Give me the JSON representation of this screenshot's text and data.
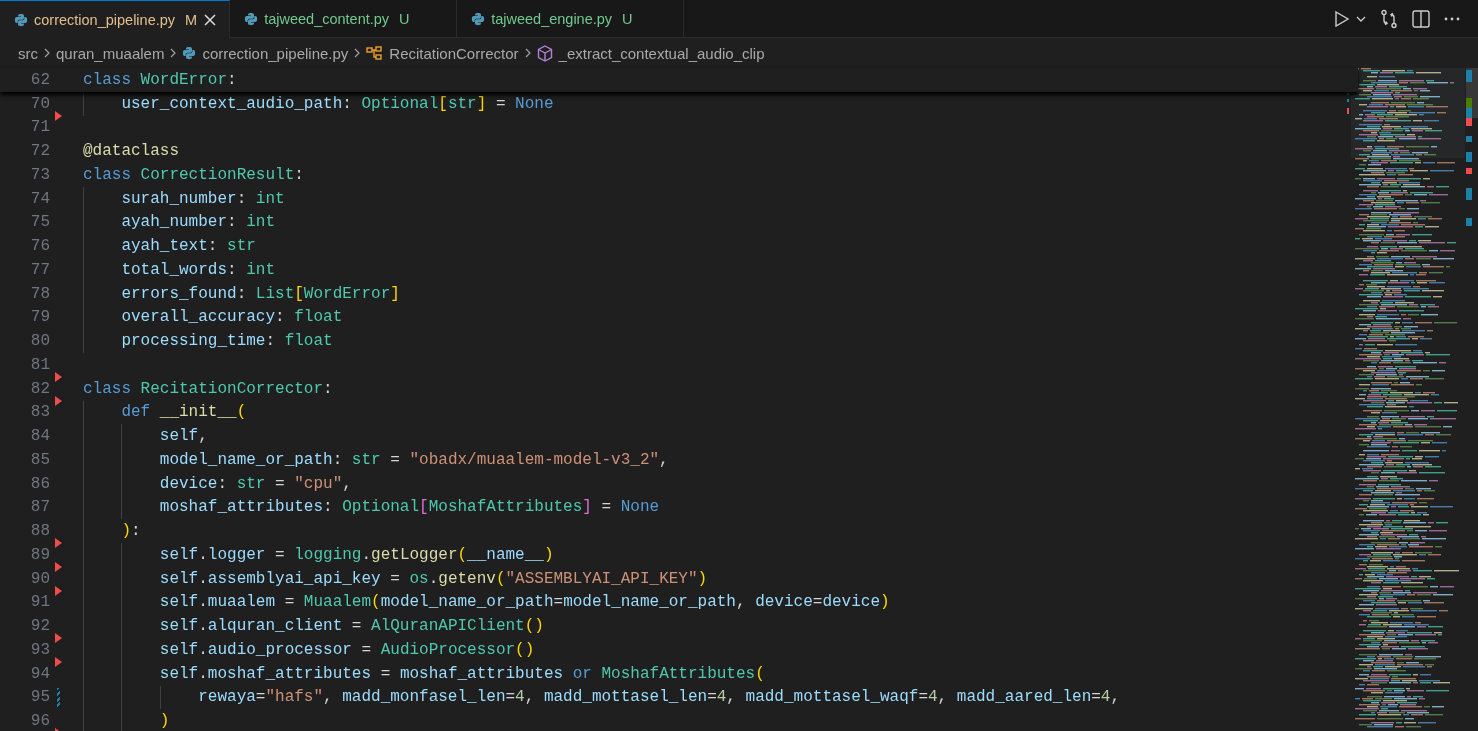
{
  "tabs": [
    {
      "label": "correction_pipeline.py",
      "kind": "modified",
      "badge": "M",
      "selected": true
    },
    {
      "label": "tajweed_content.py",
      "kind": "untracked",
      "badge": "U",
      "selected": false
    },
    {
      "label": "tajweed_engine.py",
      "kind": "untracked",
      "badge": "U",
      "selected": false
    }
  ],
  "breadcrumb": [
    {
      "kind": "folder",
      "label": "src"
    },
    {
      "kind": "folder",
      "label": "quran_muaalem"
    },
    {
      "kind": "file",
      "label": "correction_pipeline.py"
    },
    {
      "kind": "class",
      "label": "RecitationCorrector"
    },
    {
      "kind": "method",
      "label": "_extract_contextual_audio_clip"
    }
  ],
  "sticky_scroll": {
    "number": "62",
    "tokens": [
      {
        "kind": "kw",
        "text": "class "
      },
      {
        "kind": "cls",
        "text": "WordError"
      },
      {
        "kind": "op",
        "text": ":"
      }
    ]
  },
  "lines": [
    {
      "number": "70",
      "kind": "deleted",
      "tokens": [
        {
          "kind": "var",
          "text": "    user_context_audio_path"
        },
        {
          "kind": "op",
          "text": ": "
        },
        {
          "kind": "cls",
          "text": "Optional"
        },
        {
          "kind": "br1",
          "text": "["
        },
        {
          "kind": "cls",
          "text": "str"
        },
        {
          "kind": "br1",
          "text": "]"
        },
        {
          "kind": "op",
          "text": " = "
        },
        {
          "kind": "kw",
          "text": "None"
        }
      ]
    },
    {
      "number": "71",
      "kind": "normal"
    },
    {
      "number": "72",
      "kind": "normal",
      "tokens": [
        {
          "kind": "fn",
          "text": "@dataclass"
        }
      ]
    },
    {
      "number": "73",
      "kind": "normal",
      "tokens": [
        {
          "kind": "kw",
          "text": "class "
        },
        {
          "kind": "cls",
          "text": "CorrectionResult"
        },
        {
          "kind": "op",
          "text": ":"
        }
      ]
    },
    {
      "number": "74",
      "kind": "normal",
      "tokens": [
        {
          "kind": "var",
          "text": "    surah_number"
        },
        {
          "kind": "op",
          "text": ": "
        },
        {
          "kind": "cls",
          "text": "int"
        }
      ]
    },
    {
      "number": "75",
      "kind": "normal",
      "tokens": [
        {
          "kind": "var",
          "text": "    ayah_number"
        },
        {
          "kind": "op",
          "text": ": "
        },
        {
          "kind": "cls",
          "text": "int"
        }
      ]
    },
    {
      "number": "76",
      "kind": "normal",
      "tokens": [
        {
          "kind": "var",
          "text": "    ayah_text"
        },
        {
          "kind": "op",
          "text": ": "
        },
        {
          "kind": "cls",
          "text": "str"
        }
      ]
    },
    {
      "number": "77",
      "kind": "normal",
      "tokens": [
        {
          "kind": "var",
          "text": "    total_words"
        },
        {
          "kind": "op",
          "text": ": "
        },
        {
          "kind": "cls",
          "text": "int"
        }
      ]
    },
    {
      "number": "78",
      "kind": "normal",
      "tokens": [
        {
          "kind": "var",
          "text": "    errors_found"
        },
        {
          "kind": "op",
          "text": ": "
        },
        {
          "kind": "cls",
          "text": "List"
        },
        {
          "kind": "br1",
          "text": "["
        },
        {
          "kind": "cls",
          "text": "WordError"
        },
        {
          "kind": "br1",
          "text": "]"
        }
      ]
    },
    {
      "number": "79",
      "kind": "normal",
      "tokens": [
        {
          "kind": "var",
          "text": "    overall_accuracy"
        },
        {
          "kind": "op",
          "text": ": "
        },
        {
          "kind": "cls",
          "text": "float"
        }
      ]
    },
    {
      "number": "80",
      "kind": "normal",
      "tokens": [
        {
          "kind": "var",
          "text": "    processing_time"
        },
        {
          "kind": "op",
          "text": ": "
        },
        {
          "kind": "cls",
          "text": "float"
        }
      ]
    },
    {
      "number": "81",
      "kind": "deleted"
    },
    {
      "number": "82",
      "kind": "deleted",
      "tokens": [
        {
          "kind": "kw",
          "text": "class "
        },
        {
          "kind": "cls",
          "text": "RecitationCorrector"
        },
        {
          "kind": "op",
          "text": ":"
        }
      ]
    },
    {
      "number": "83",
      "kind": "normal",
      "tokens": [
        {
          "kind": "kw",
          "text": "    def "
        },
        {
          "kind": "fn",
          "text": "__init__"
        },
        {
          "kind": "br1",
          "text": "("
        }
      ]
    },
    {
      "number": "84",
      "kind": "normal",
      "tokens": [
        {
          "kind": "var",
          "text": "        self"
        },
        {
          "kind": "op",
          "text": ","
        }
      ]
    },
    {
      "number": "85",
      "kind": "normal",
      "tokens": [
        {
          "kind": "var",
          "text": "        model_name_or_path"
        },
        {
          "kind": "op",
          "text": ": "
        },
        {
          "kind": "cls",
          "text": "str"
        },
        {
          "kind": "op",
          "text": " = "
        },
        {
          "kind": "str",
          "text": "\"obadx/muaalem-model-v3_2\""
        },
        {
          "kind": "op",
          "text": ","
        }
      ]
    },
    {
      "number": "86",
      "kind": "normal",
      "tokens": [
        {
          "kind": "var",
          "text": "        device"
        },
        {
          "kind": "op",
          "text": ": "
        },
        {
          "kind": "cls",
          "text": "str"
        },
        {
          "kind": "op",
          "text": " = "
        },
        {
          "kind": "str",
          "text": "\"cpu\""
        },
        {
          "kind": "op",
          "text": ","
        }
      ]
    },
    {
      "number": "87",
      "kind": "normal",
      "tokens": [
        {
          "kind": "var",
          "text": "        moshaf_attributes"
        },
        {
          "kind": "op",
          "text": ": "
        },
        {
          "kind": "cls",
          "text": "Optional"
        },
        {
          "kind": "br2",
          "text": "["
        },
        {
          "kind": "cls",
          "text": "MoshafAttributes"
        },
        {
          "kind": "br2",
          "text": "]"
        },
        {
          "kind": "op",
          "text": " = "
        },
        {
          "kind": "kw",
          "text": "None"
        }
      ]
    },
    {
      "number": "88",
      "kind": "deleted",
      "tokens": [
        {
          "kind": "br1",
          "text": "    )"
        },
        {
          "kind": "op",
          "text": ":"
        }
      ]
    },
    {
      "number": "89",
      "kind": "deleted",
      "tokens": [
        {
          "kind": "var",
          "text": "        self"
        },
        {
          "kind": "op",
          "text": "."
        },
        {
          "kind": "var",
          "text": "logger"
        },
        {
          "kind": "op",
          "text": " = "
        },
        {
          "kind": "cls",
          "text": "logging"
        },
        {
          "kind": "op",
          "text": "."
        },
        {
          "kind": "fn",
          "text": "getLogger"
        },
        {
          "kind": "br1",
          "text": "("
        },
        {
          "kind": "var",
          "text": "__name__"
        },
        {
          "kind": "br1",
          "text": ")"
        }
      ]
    },
    {
      "number": "90",
      "kind": "deleted",
      "tokens": [
        {
          "kind": "var",
          "text": "        self"
        },
        {
          "kind": "op",
          "text": "."
        },
        {
          "kind": "var",
          "text": "assemblyai_api_key"
        },
        {
          "kind": "op",
          "text": " = "
        },
        {
          "kind": "cls",
          "text": "os"
        },
        {
          "kind": "op",
          "text": "."
        },
        {
          "kind": "fn",
          "text": "getenv"
        },
        {
          "kind": "br1",
          "text": "("
        },
        {
          "kind": "str",
          "text": "\"ASSEMBLYAI_API_KEY\""
        },
        {
          "kind": "br1",
          "text": ")"
        }
      ]
    },
    {
      "number": "91",
      "kind": "normal",
      "tokens": [
        {
          "kind": "var",
          "text": "        self"
        },
        {
          "kind": "op",
          "text": "."
        },
        {
          "kind": "var",
          "text": "muaalem"
        },
        {
          "kind": "op",
          "text": " = "
        },
        {
          "kind": "cls",
          "text": "Muaalem"
        },
        {
          "kind": "br1",
          "text": "("
        },
        {
          "kind": "var",
          "text": "model_name_or_path"
        },
        {
          "kind": "op",
          "text": "="
        },
        {
          "kind": "var",
          "text": "model_name_or_path"
        },
        {
          "kind": "op",
          "text": ", "
        },
        {
          "kind": "var",
          "text": "device"
        },
        {
          "kind": "op",
          "text": "="
        },
        {
          "kind": "var",
          "text": "device"
        },
        {
          "kind": "br1",
          "text": ")"
        }
      ]
    },
    {
      "number": "92",
      "kind": "deleted",
      "tokens": [
        {
          "kind": "var",
          "text": "        self"
        },
        {
          "kind": "op",
          "text": "."
        },
        {
          "kind": "var",
          "text": "alquran_client"
        },
        {
          "kind": "op",
          "text": " = "
        },
        {
          "kind": "cls",
          "text": "AlQuranAPIClient"
        },
        {
          "kind": "br1",
          "text": "()"
        }
      ]
    },
    {
      "number": "93",
      "kind": "deleted",
      "tokens": [
        {
          "kind": "var",
          "text": "        self"
        },
        {
          "kind": "op",
          "text": "."
        },
        {
          "kind": "var",
          "text": "audio_processor"
        },
        {
          "kind": "op",
          "text": " = "
        },
        {
          "kind": "cls",
          "text": "AudioProcessor"
        },
        {
          "kind": "br1",
          "text": "()"
        }
      ]
    },
    {
      "number": "94",
      "kind": "normal",
      "tokens": [
        {
          "kind": "var",
          "text": "        self"
        },
        {
          "kind": "op",
          "text": "."
        },
        {
          "kind": "var",
          "text": "moshaf_attributes"
        },
        {
          "kind": "op",
          "text": " = "
        },
        {
          "kind": "var",
          "text": "moshaf_attributes"
        },
        {
          "kind": "kw",
          "text": " or "
        },
        {
          "kind": "cls",
          "text": "MoshafAttributes"
        },
        {
          "kind": "br1",
          "text": "("
        }
      ]
    },
    {
      "number": "95",
      "kind": "modified",
      "tokens": [
        {
          "kind": "var",
          "text": "            rewaya"
        },
        {
          "kind": "op",
          "text": "="
        },
        {
          "kind": "str",
          "text": "\"hafs\""
        },
        {
          "kind": "op",
          "text": ", "
        },
        {
          "kind": "var",
          "text": "madd_monfasel_len"
        },
        {
          "kind": "op",
          "text": "="
        },
        {
          "kind": "num",
          "text": "4"
        },
        {
          "kind": "op",
          "text": ", "
        },
        {
          "kind": "var",
          "text": "madd_mottasel_len"
        },
        {
          "kind": "op",
          "text": "="
        },
        {
          "kind": "num",
          "text": "4"
        },
        {
          "kind": "op",
          "text": ", "
        },
        {
          "kind": "var",
          "text": "madd_mottasel_waqf"
        },
        {
          "kind": "op",
          "text": "="
        },
        {
          "kind": "num",
          "text": "4"
        },
        {
          "kind": "op",
          "text": ", "
        },
        {
          "kind": "var",
          "text": "madd_aared_len"
        },
        {
          "kind": "op",
          "text": "="
        },
        {
          "kind": "num",
          "text": "4"
        },
        {
          "kind": "op",
          "text": ","
        }
      ]
    },
    {
      "number": "96",
      "kind": "deleted",
      "tokens": [
        {
          "kind": "br1",
          "text": "        )"
        }
      ]
    }
  ]
}
